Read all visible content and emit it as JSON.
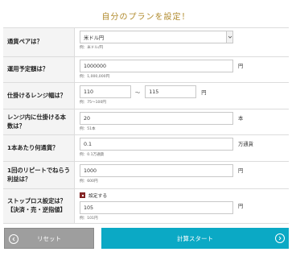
{
  "title": "自分のプランを設定！",
  "fields": {
    "pair": {
      "label": "通貨ペアは？",
      "value": "米ドル円",
      "hint": "例：米ドル/円"
    },
    "capital": {
      "label": "運用予定額は？",
      "value": "1000000",
      "unit": "円",
      "hint": "例：1,000,000円"
    },
    "range": {
      "label": "仕掛けるレンジ幅は？",
      "from": "110",
      "separator": "〜",
      "to": "115",
      "unit": "円",
      "hint": "例：75〜100円"
    },
    "count": {
      "label": "レンジ内に仕掛ける本数は？",
      "value": "20",
      "unit": "本",
      "hint": "例：51本"
    },
    "lot": {
      "label": "1本あたり何通貨？",
      "value": "0.1",
      "unit": "万通貨",
      "hint": "例：0.1万通貨"
    },
    "profit": {
      "label": "1回のリピートでねらう利益は？",
      "value": "1000",
      "unit": "円",
      "hint": "例：600円"
    },
    "stoploss": {
      "label": "ストップロス設定は？【決済・売・逆指値】",
      "checkbox_label": "設定する",
      "checked": true,
      "value": "105",
      "unit": "円",
      "hint": "例：101円"
    }
  },
  "buttons": {
    "reset": "リセット",
    "start": "計算スタート"
  },
  "colors": {
    "title": "#b08a2c",
    "start": "#0ba9c5",
    "reset": "#9e9e9e",
    "checkbox": "#8b2a2a"
  }
}
